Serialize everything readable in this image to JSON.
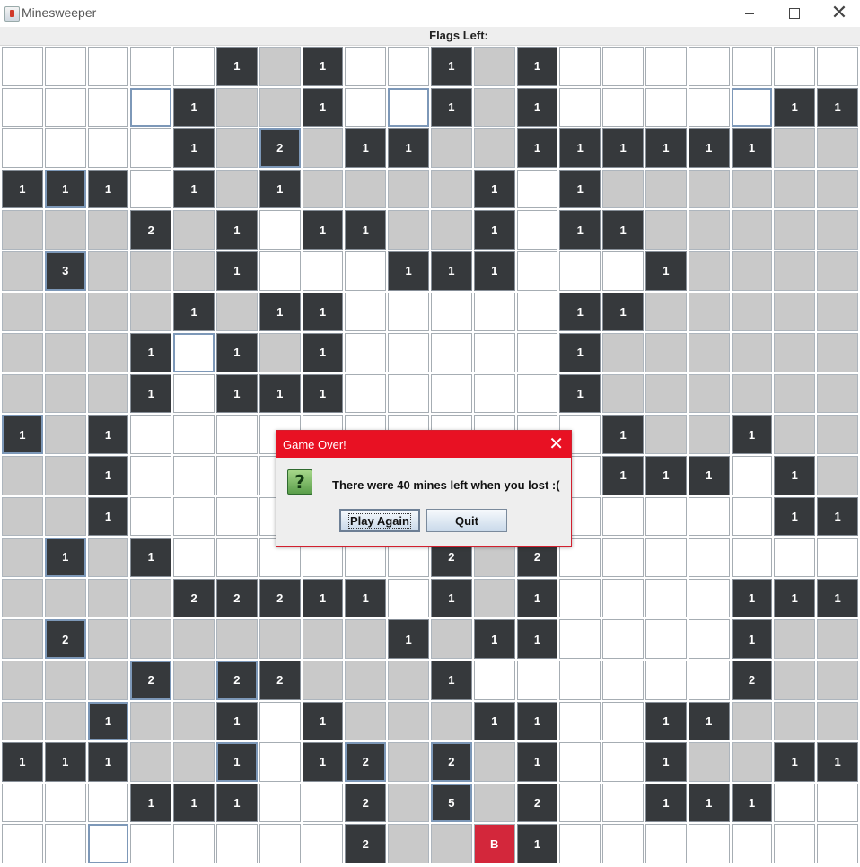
{
  "window": {
    "title": "Minesweeper",
    "app_icon": "minesweeper-app-icon",
    "controls": [
      "minimize-icon",
      "maximize-icon",
      "close-icon"
    ]
  },
  "status": {
    "flags_left_label": "Flags Left:"
  },
  "board": {
    "rows": 20,
    "cols": 20,
    "legend": {
      "U": "unrevealed",
      "E": "revealed-empty",
      "B": "mine",
      "digit": "revealed-number"
    },
    "colors": {
      "unrevealed": "#ffffff",
      "empty": "#c9c9c9",
      "number": "#36393c",
      "mine": "#d3273b",
      "highlight_border": "#7d98b8"
    },
    "cells": [
      [
        "U",
        "U",
        "U",
        "U",
        "U",
        "1",
        "E",
        "1",
        "U",
        "U",
        "1",
        "E",
        "1",
        "U",
        "U",
        "U",
        "U",
        "U",
        "U",
        "U"
      ],
      [
        "U",
        "U",
        "U",
        "U",
        "1",
        "E",
        "E",
        "1",
        "U",
        "U",
        "1",
        "E",
        "1",
        "U",
        "U",
        "U",
        "U",
        "U",
        "1",
        "1"
      ],
      [
        "U",
        "U",
        "U",
        "U",
        "1",
        "E",
        "2",
        "E",
        "1",
        "1",
        "E",
        "E",
        "1",
        "1",
        "1",
        "1",
        "1",
        "1",
        "E",
        "E"
      ],
      [
        "1",
        "1",
        "1",
        "U",
        "1",
        "E",
        "1",
        "E",
        "E",
        "E",
        "E",
        "1",
        "U",
        "1",
        "E",
        "E",
        "E",
        "E",
        "E",
        "E"
      ],
      [
        "E",
        "E",
        "E",
        "2",
        "E",
        "1",
        "U",
        "1",
        "1",
        "E",
        "E",
        "1",
        "U",
        "1",
        "1",
        "E",
        "E",
        "E",
        "E",
        "E"
      ],
      [
        "E",
        "3",
        "E",
        "E",
        "E",
        "1",
        "U",
        "U",
        "U",
        "1",
        "1",
        "1",
        "U",
        "U",
        "U",
        "1",
        "E",
        "E",
        "E",
        "E"
      ],
      [
        "E",
        "E",
        "E",
        "E",
        "1",
        "E",
        "1",
        "1",
        "U",
        "U",
        "U",
        "U",
        "U",
        "1",
        "1",
        "E",
        "E",
        "E",
        "E",
        "E"
      ],
      [
        "E",
        "E",
        "E",
        "1",
        "U",
        "1",
        "E",
        "1",
        "U",
        "U",
        "U",
        "U",
        "U",
        "1",
        "E",
        "E",
        "E",
        "E",
        "E",
        "E"
      ],
      [
        "E",
        "E",
        "E",
        "1",
        "U",
        "1",
        "1",
        "1",
        "U",
        "U",
        "U",
        "U",
        "U",
        "1",
        "E",
        "E",
        "E",
        "E",
        "E",
        "E"
      ],
      [
        "1",
        "E",
        "1",
        "U",
        "U",
        "U",
        "U",
        "U",
        "U",
        "U",
        "U",
        "U",
        "U",
        "U",
        "1",
        "E",
        "E",
        "1",
        "E",
        "E"
      ],
      [
        "E",
        "E",
        "1",
        "U",
        "U",
        "U",
        "U",
        "U",
        "U",
        "U",
        "U",
        "U",
        "U",
        "U",
        "1",
        "1",
        "1",
        "U",
        "1",
        "E"
      ],
      [
        "E",
        "E",
        "1",
        "U",
        "U",
        "U",
        "U",
        "U",
        "U",
        "U",
        "U",
        "U",
        "U",
        "U",
        "U",
        "U",
        "U",
        "U",
        "1",
        "1"
      ],
      [
        "E",
        "1",
        "E",
        "1",
        "U",
        "U",
        "U",
        "U",
        "U",
        "U",
        "2",
        "E",
        "2",
        "U",
        "U",
        "U",
        "U",
        "U",
        "U",
        "U"
      ],
      [
        "E",
        "E",
        "E",
        "E",
        "2",
        "2",
        "2",
        "1",
        "1",
        "U",
        "1",
        "E",
        "1",
        "U",
        "U",
        "U",
        "U",
        "1",
        "1",
        "1"
      ],
      [
        "E",
        "2",
        "E",
        "E",
        "E",
        "E",
        "E",
        "E",
        "E",
        "1",
        "E",
        "1",
        "1",
        "U",
        "U",
        "U",
        "U",
        "1",
        "E",
        "E"
      ],
      [
        "E",
        "E",
        "E",
        "2",
        "E",
        "2",
        "2",
        "E",
        "E",
        "E",
        "1",
        "U",
        "U",
        "U",
        "U",
        "U",
        "U",
        "2",
        "E",
        "E"
      ],
      [
        "E",
        "E",
        "1",
        "E",
        "E",
        "1",
        "U",
        "1",
        "E",
        "E",
        "E",
        "1",
        "1",
        "U",
        "U",
        "1",
        "1",
        "E",
        "E",
        "E"
      ],
      [
        "1",
        "1",
        "1",
        "E",
        "E",
        "1",
        "U",
        "1",
        "2",
        "E",
        "2",
        "E",
        "1",
        "U",
        "U",
        "1",
        "E",
        "E",
        "1",
        "1"
      ],
      [
        "U",
        "U",
        "U",
        "1",
        "1",
        "1",
        "U",
        "U",
        "2",
        "E",
        "5",
        "E",
        "2",
        "U",
        "U",
        "1",
        "1",
        "1",
        "U",
        "U"
      ],
      [
        "U",
        "U",
        "U",
        "U",
        "U",
        "U",
        "U",
        "U",
        "2",
        "E",
        "E",
        "B",
        "1",
        "U",
        "U",
        "U",
        "U",
        "U",
        "U",
        "U"
      ]
    ],
    "highlighted": [
      [
        1,
        3
      ],
      [
        1,
        9
      ],
      [
        1,
        17
      ],
      [
        2,
        6
      ],
      [
        3,
        1
      ],
      [
        5,
        1
      ],
      [
        7,
        4
      ],
      [
        9,
        0
      ],
      [
        12,
        1
      ],
      [
        14,
        1
      ],
      [
        15,
        3
      ],
      [
        15,
        5
      ],
      [
        16,
        2
      ],
      [
        17,
        5
      ],
      [
        17,
        8
      ],
      [
        17,
        10
      ],
      [
        18,
        10
      ],
      [
        19,
        2
      ]
    ]
  },
  "dialog": {
    "title": "Game Over!",
    "icon": "question-icon",
    "icon_glyph": "?",
    "message": "There were 40 mines left when you lost :(",
    "buttons": {
      "play_again": "Play Again",
      "quit": "Quit"
    },
    "accent": "#e81123"
  }
}
